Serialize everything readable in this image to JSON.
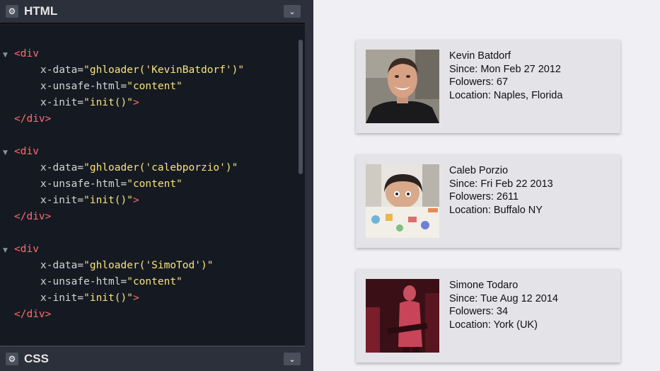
{
  "editor": {
    "html_panel": {
      "title": "HTML",
      "gear_glyph": "⚙",
      "collapse_glyph": "⌄"
    },
    "css_panel": {
      "title": "CSS",
      "gear_glyph": "⚙",
      "collapse_glyph": "⌄"
    },
    "code_blocks": [
      {
        "open_tag": "<div",
        "x_data_attr": "x-data=",
        "x_data_value": "\"ghloader('KevinBatdorf')\"",
        "x_html_attr": "x-unsafe-html=",
        "x_html_value": "\"content\"",
        "x_init_attr": "x-init=",
        "x_init_value": "\"init()\"",
        "x_init_end": ">",
        "close_tag": "</div>"
      },
      {
        "open_tag": "<div",
        "x_data_attr": "x-data=",
        "x_data_value": "\"ghloader('calebporzio')\"",
        "x_html_attr": "x-unsafe-html=",
        "x_html_value": "\"content\"",
        "x_init_attr": "x-init=",
        "x_init_value": "\"init()\"",
        "x_init_end": ">",
        "close_tag": "</div>"
      },
      {
        "open_tag": "<div",
        "x_data_attr": "x-data=",
        "x_data_value": "\"ghloader('SimoTod')\"",
        "x_html_attr": "x-unsafe-html=",
        "x_html_value": "\"content\"",
        "x_init_attr": "x-init=",
        "x_init_value": "\"init()\"",
        "x_init_end": ">",
        "close_tag": "</div>"
      }
    ]
  },
  "preview": {
    "cards": [
      {
        "name": "Kevin Batdorf",
        "since": "Since: Mon Feb 27 2012",
        "followers": "Folowers: 67",
        "location": "Location: Naples, Florida"
      },
      {
        "name": "Caleb Porzio",
        "since": "Since: Fri Feb 22 2013",
        "followers": "Folowers: 2611",
        "location": "Location: Buffalo NY"
      },
      {
        "name": "Simone Todaro",
        "since": "Since: Tue Aug 12 2014",
        "followers": "Folowers: 34",
        "location": "Location: York (UK)"
      }
    ]
  }
}
